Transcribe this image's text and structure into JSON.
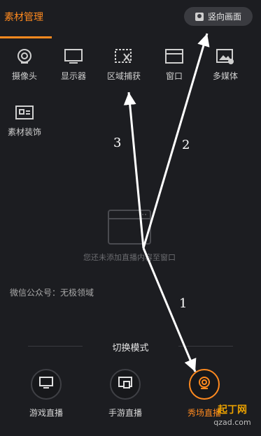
{
  "header": {
    "active_tab": "素材管理",
    "vertical_button": "竖向画面"
  },
  "sources": [
    {
      "label": "摄像头",
      "icon": "camera-icon"
    },
    {
      "label": "显示器",
      "icon": "monitor-icon"
    },
    {
      "label": "区域捕获",
      "icon": "region-capture-icon"
    },
    {
      "label": "窗口",
      "icon": "window-icon"
    },
    {
      "label": "多媒体",
      "icon": "media-icon"
    },
    {
      "label": "素材装饰",
      "icon": "decoration-icon"
    }
  ],
  "empty_state": {
    "text": "您还未添加直播内容至窗口"
  },
  "wechat_note": "微信公众号：无极领域",
  "mode_switch": {
    "title": "切换模式",
    "modes": [
      {
        "label": "游戏直播",
        "icon": "tv-icon"
      },
      {
        "label": "手游直播",
        "icon": "phone-cast-icon"
      },
      {
        "label": "秀场直播",
        "icon": "webcam-icon"
      }
    ]
  },
  "annotations": [
    "1",
    "2",
    "3"
  ],
  "watermark": {
    "line1": "起丁网",
    "line2": "qzad.com"
  },
  "colors": {
    "background": "#1c1d21",
    "accent": "#ff8a1f",
    "text": "#cfcfcf"
  }
}
